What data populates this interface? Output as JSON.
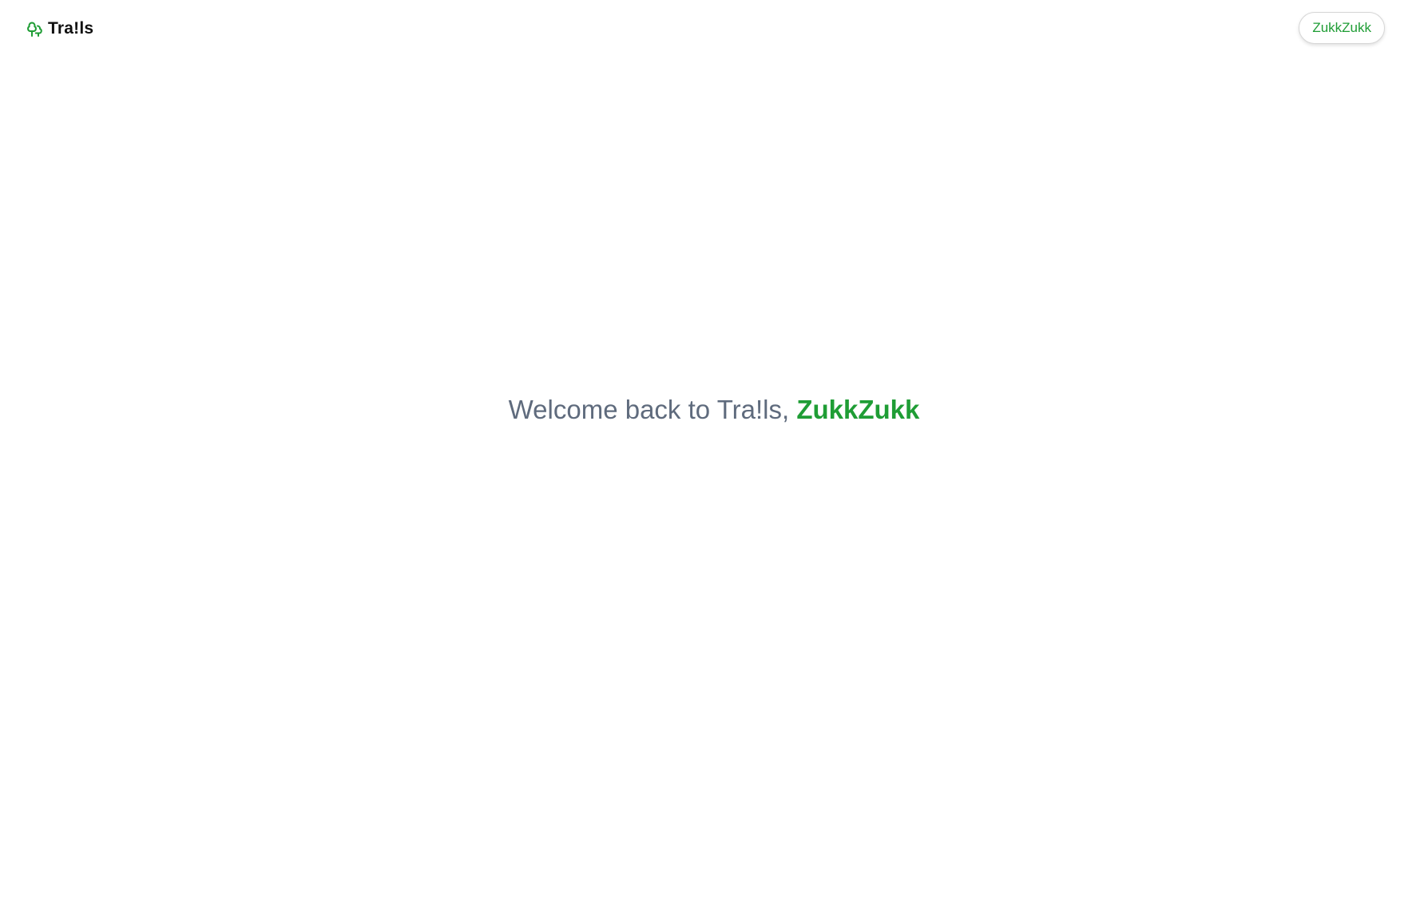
{
  "header": {
    "brand_name": "Tra!ls",
    "brand_icon": "trees-icon",
    "user_button_label": "ZukkZukk"
  },
  "main": {
    "welcome_prefix": "Welcome back to Tra!ls,",
    "welcome_name": "ZukkZukk"
  },
  "colors": {
    "accent": "#1f9d35",
    "text_muted": "#5f6b7d",
    "brand_text": "#111111",
    "background": "#ffffff"
  }
}
